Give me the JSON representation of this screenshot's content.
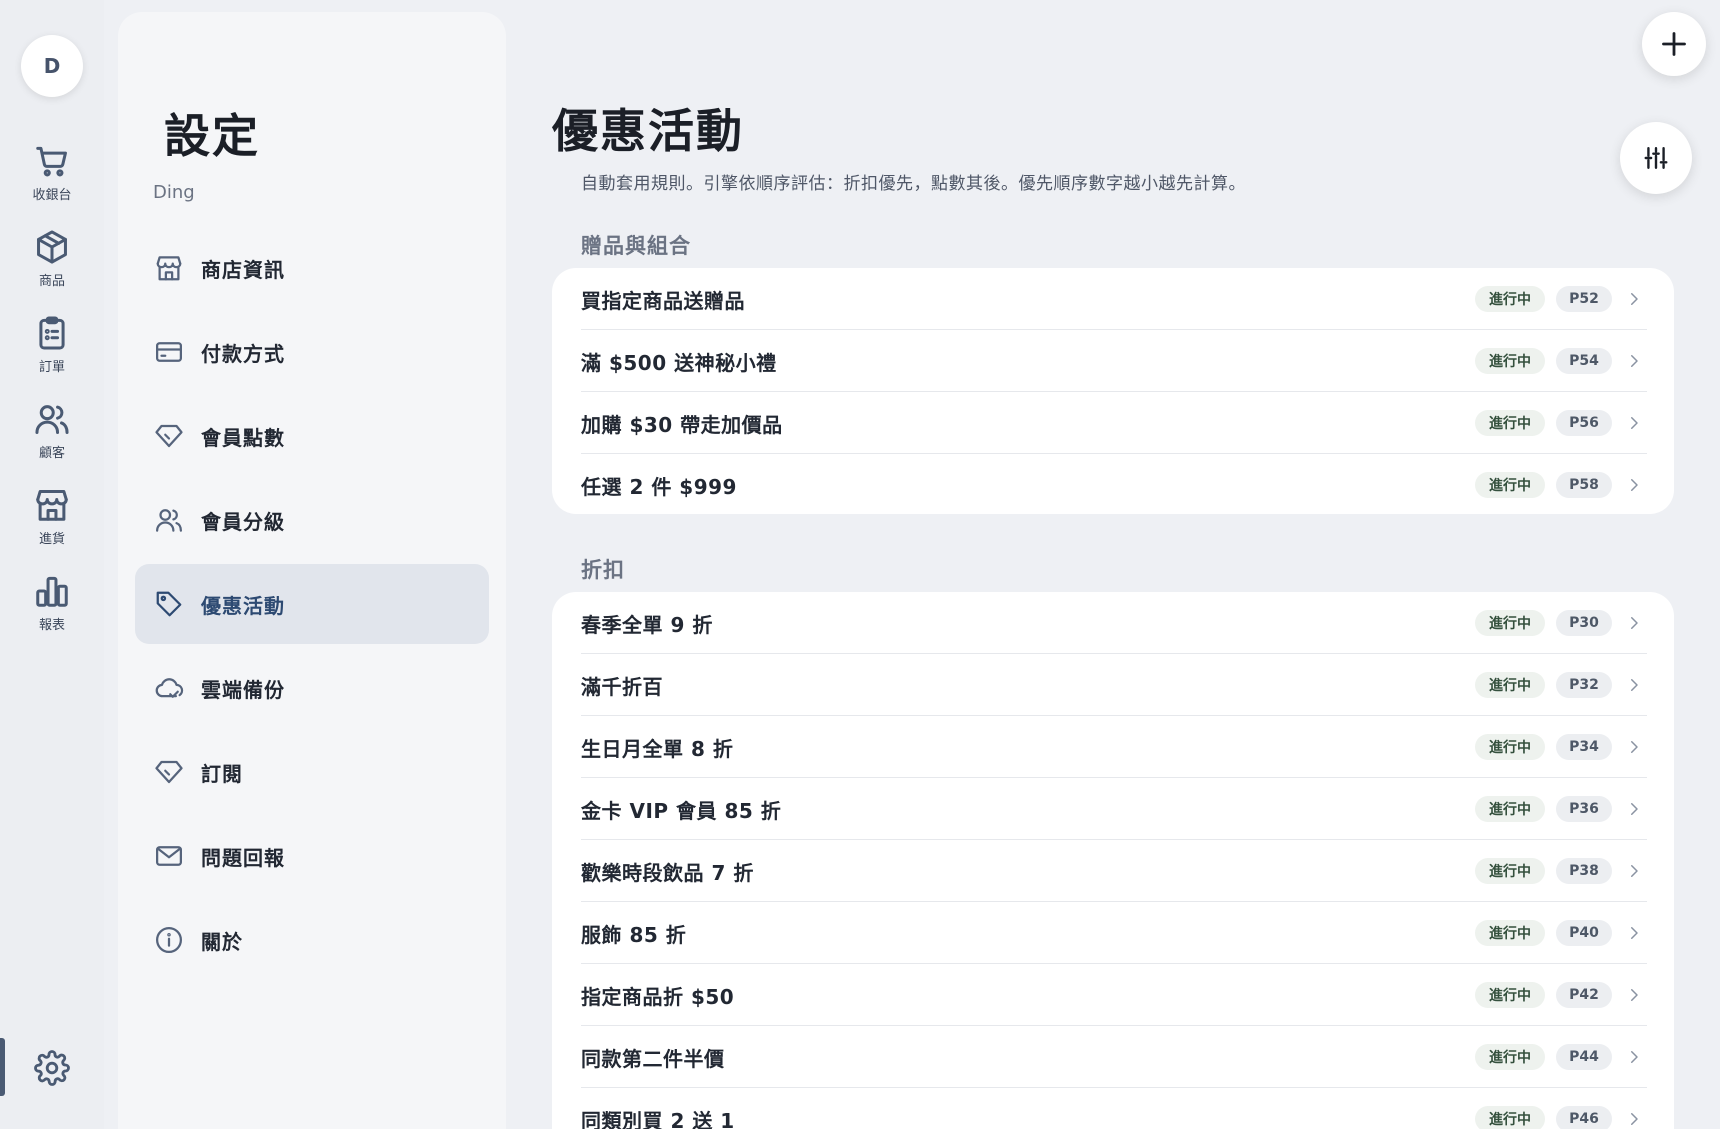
{
  "rail": {
    "avatar": "D",
    "items": [
      {
        "label": "收銀台",
        "icon": "cart-icon"
      },
      {
        "label": "商品",
        "icon": "box-icon"
      },
      {
        "label": "訂單",
        "icon": "clipboard-icon"
      },
      {
        "label": "顧客",
        "icon": "users-icon"
      },
      {
        "label": "進貨",
        "icon": "store-icon"
      },
      {
        "label": "報表",
        "icon": "bar-chart-icon"
      }
    ],
    "settings_icon": "gear-icon"
  },
  "panel": {
    "title": "設定",
    "subtitle": "Ding",
    "items": [
      {
        "label": "商店資訊",
        "icon": "store-icon"
      },
      {
        "label": "付款方式",
        "icon": "credit-card-icon"
      },
      {
        "label": "會員點數",
        "icon": "diamond-icon"
      },
      {
        "label": "會員分級",
        "icon": "users-icon"
      },
      {
        "label": "優惠活動",
        "icon": "tag-icon",
        "active": true
      },
      {
        "label": "雲端備份",
        "icon": "cloud-check-icon"
      },
      {
        "label": "訂閱",
        "icon": "diamond-icon"
      },
      {
        "label": "問題回報",
        "icon": "mail-icon"
      },
      {
        "label": "關於",
        "icon": "info-icon"
      }
    ]
  },
  "main": {
    "title": "優惠活動",
    "description": "自動套用規則。引擎依順序評估：折扣優先，點數其後。優先順序數字越小越先計算。",
    "sections": [
      {
        "heading": "贈品與組合",
        "rows": [
          {
            "title": "買指定商品送贈品",
            "status": "進行中",
            "priority": "P52"
          },
          {
            "title": "滿 $500 送神秘小禮",
            "status": "進行中",
            "priority": "P54"
          },
          {
            "title": "加購 $30 帶走加價品",
            "status": "進行中",
            "priority": "P56"
          },
          {
            "title": "任選 2 件 $999",
            "status": "進行中",
            "priority": "P58"
          }
        ]
      },
      {
        "heading": "折扣",
        "rows": [
          {
            "title": "春季全單 9 折",
            "status": "進行中",
            "priority": "P30"
          },
          {
            "title": "滿千折百",
            "status": "進行中",
            "priority": "P32"
          },
          {
            "title": "生日月全單 8 折",
            "status": "進行中",
            "priority": "P34"
          },
          {
            "title": "金卡 VIP 會員 85 折",
            "status": "進行中",
            "priority": "P36"
          },
          {
            "title": "歡樂時段飲品 7 折",
            "status": "進行中",
            "priority": "P38"
          },
          {
            "title": "服飾 85 折",
            "status": "進行中",
            "priority": "P40"
          },
          {
            "title": "指定商品折 $50",
            "status": "進行中",
            "priority": "P42"
          },
          {
            "title": "同款第二件半價",
            "status": "進行中",
            "priority": "P44"
          },
          {
            "title": "同類別買 2 送 1",
            "status": "進行中",
            "priority": "P46"
          }
        ]
      }
    ]
  },
  "fab": {
    "add_icon": "plus-icon",
    "filter_icon": "sliders-icon"
  }
}
